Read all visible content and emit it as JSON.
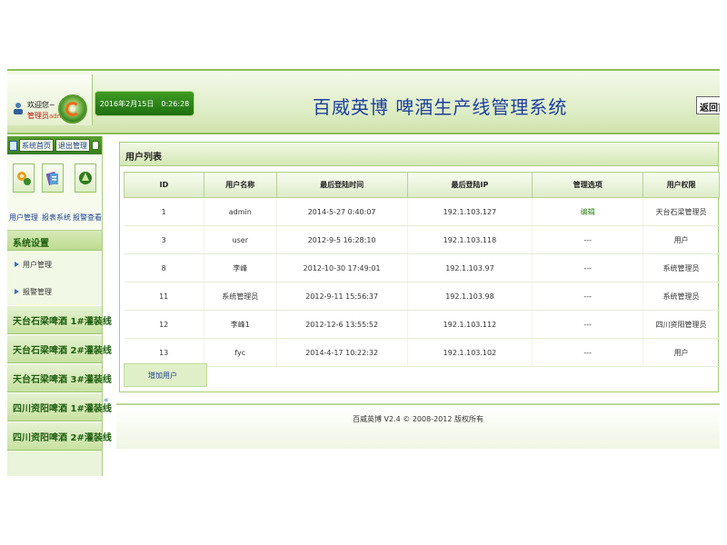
{
  "header": {
    "welcome": "欢迎您~",
    "role_label": "管理员",
    "username": "admin",
    "date": "2016年2月15日",
    "time": "0:26:28",
    "title": "百威英博  啤酒生产线管理系统",
    "back_home": "返回首页"
  },
  "sidebar": {
    "top_links": [
      "系统首页",
      "退出管理"
    ],
    "quick_buttons": [
      {
        "label": "用户管理",
        "icon": "gear-user-icon"
      },
      {
        "label": "报表系统",
        "icon": "report-icon"
      },
      {
        "label": "报警查看",
        "icon": "alarm-icon"
      }
    ],
    "section_title": "系统设置",
    "sub_items": [
      "用户管理",
      "报警管理"
    ],
    "lines": [
      "天台石梁啤酒 1#灌装线",
      "天台石梁啤酒 2#灌装线",
      "天台石梁啤酒 3#灌装线",
      "四川资阳啤酒 1#灌装线",
      "四川资阳啤酒 2#灌装线"
    ],
    "collapse": "«"
  },
  "panel": {
    "title": "用户列表",
    "columns": [
      "ID",
      "用户名称",
      "最后登陆时间",
      "最后登陆IP",
      "管理选项",
      "用户权限"
    ],
    "rows": [
      [
        "1",
        "admin",
        "2014-5-27 0:40:07",
        "192.1.103.127",
        "编辑",
        "天台石梁管理员"
      ],
      [
        "3",
        "user",
        "2012-9-5 16:28:10",
        "192.1.103.118",
        "---",
        "用户"
      ],
      [
        "8",
        "李峰",
        "2012-10-30 17:49:01",
        "192.1.103.97",
        "---",
        "系统管理员"
      ],
      [
        "11",
        "系统管理员",
        "2012-9-11 15:56:37",
        "192.1.103.98",
        "---",
        "系统管理员"
      ],
      [
        "12",
        "李峰1",
        "2012-12-6 13:55:52",
        "192.1.103.112",
        "---",
        "四川资阳管理员"
      ],
      [
        "13",
        "fyc",
        "2014-4-17 10:22:32",
        "192.1.103.102",
        "---",
        "用户"
      ]
    ],
    "add_user": "增加用户"
  },
  "footer": {
    "text": "百威英博  V2.4 © 2008-2012 版权所有"
  },
  "colors": {
    "accent_green": "#3a7e1e",
    "title_blue": "#1d3f9e",
    "border_green": "#a8cc7a"
  }
}
